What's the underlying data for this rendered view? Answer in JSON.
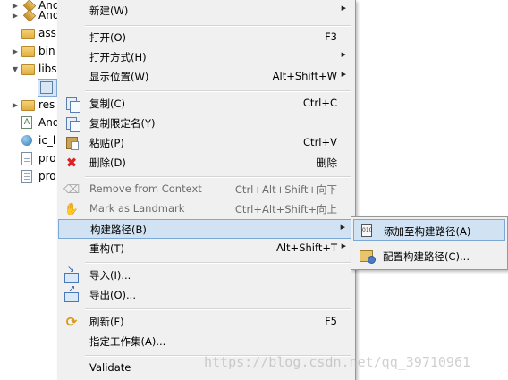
{
  "tree": {
    "items": [
      {
        "label": "And",
        "twisty": "▶",
        "icon": "package-icon"
      },
      {
        "label": "ass",
        "twisty": "",
        "icon": "folder-icon"
      },
      {
        "label": "bin",
        "twisty": "▶",
        "icon": "folder-icon"
      },
      {
        "label": "libs",
        "twisty": "▼",
        "icon": "folder-icon"
      },
      {
        "label": "",
        "twisty": "",
        "icon": "jar-icon"
      },
      {
        "label": "res",
        "twisty": "▶",
        "icon": "folder-icon"
      },
      {
        "label": "And",
        "twisty": "",
        "icon": "manifest-icon"
      },
      {
        "label": "ic_l",
        "twisty": "",
        "icon": "globe-icon"
      },
      {
        "label": "pro",
        "twisty": "",
        "icon": "file-icon"
      },
      {
        "label": "pro",
        "twisty": "",
        "icon": "file-icon"
      }
    ]
  },
  "menu": {
    "new": {
      "label": "新建(W)"
    },
    "open": {
      "label": "打开(O)",
      "shortcut": "F3"
    },
    "open_with": {
      "label": "打开方式(H)"
    },
    "show_in": {
      "label": "显示位置(W)",
      "shortcut": "Alt+Shift+W"
    },
    "copy": {
      "label": "复制(C)",
      "shortcut": "Ctrl+C"
    },
    "copy_qualified": {
      "label": "复制限定名(Y)"
    },
    "paste": {
      "label": "粘贴(P)",
      "shortcut": "Ctrl+V"
    },
    "delete": {
      "label": "删除(D)",
      "shortcut": "删除"
    },
    "remove_context": {
      "label": "Remove from Context",
      "shortcut": "Ctrl+Alt+Shift+向下"
    },
    "mark_landmark": {
      "label": "Mark as Landmark",
      "shortcut": "Ctrl+Alt+Shift+向上"
    },
    "build_path": {
      "label": "构建路径(B)"
    },
    "refactor": {
      "label": "重构(T)",
      "shortcut": "Alt+Shift+T"
    },
    "import": {
      "label": "导入(I)..."
    },
    "export": {
      "label": "导出(O)..."
    },
    "refresh": {
      "label": "刷新(F)",
      "shortcut": "F5"
    },
    "working_set": {
      "label": "指定工作集(A)..."
    },
    "validate": {
      "label": "Validate"
    }
  },
  "submenu": {
    "add_to_build_path": {
      "label": "添加至构建路径(A)"
    },
    "configure_build_path": {
      "label": "配置构建路径(C)..."
    }
  },
  "watermark": "https://blog.csdn.net/qq_39710961"
}
